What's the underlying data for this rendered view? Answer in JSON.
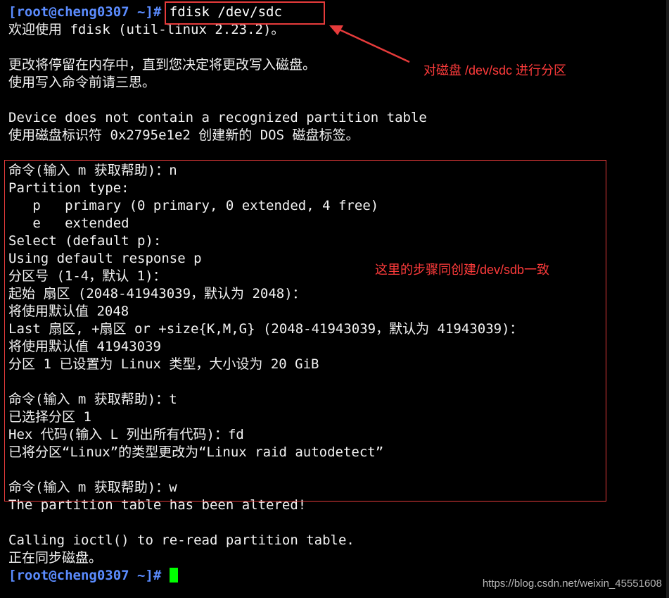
{
  "terminal": {
    "prompt": "[root@cheng0307 ~]#",
    "command": " fdisk /dev/sdc",
    "output": [
      "欢迎使用 fdisk (util-linux 2.23.2)。",
      "",
      "更改将停留在内存中，直到您决定将更改写入磁盘。",
      "使用写入命令前请三思。",
      "",
      "Device does not contain a recognized partition table",
      "使用磁盘标识符 0x2795e1e2 创建新的 DOS 磁盘标签。",
      "",
      "命令(输入 m 获取帮助)：n",
      "Partition type:",
      "   p   primary (0 primary, 0 extended, 4 free)",
      "   e   extended",
      "Select (default p):",
      "Using default response p",
      "分区号 (1-4，默认 1)：",
      "起始 扇区 (2048-41943039，默认为 2048)：",
      "将使用默认值 2048",
      "Last 扇区, +扇区 or +size{K,M,G} (2048-41943039，默认为 41943039)：",
      "将使用默认值 41943039",
      "分区 1 已设置为 Linux 类型，大小设为 20 GiB",
      "",
      "命令(输入 m 获取帮助)：t",
      "已选择分区 1",
      "Hex 代码(输入 L 列出所有代码)：fd",
      "已将分区“Linux”的类型更改为“Linux raid autodetect”",
      "",
      "命令(输入 m 获取帮助)：w",
      "The partition table has been altered!",
      "",
      "Calling ioctl() to re-read partition table.",
      "正在同步磁盘。"
    ],
    "final_prompt": "[root@cheng0307 ~]#"
  },
  "annotations": {
    "command_note": "对磁盘 /dev/sdc 进行分区",
    "block_note": "这里的步骤同创建/dev/sdb一致"
  },
  "watermark": "https://blog.csdn.net/weixin_45551608",
  "colors": {
    "background": "#000000",
    "text": "#f2f2f2",
    "prompt": "#5b8cff",
    "cursor": "#00ff00",
    "annotation": "#ff3b3b"
  }
}
